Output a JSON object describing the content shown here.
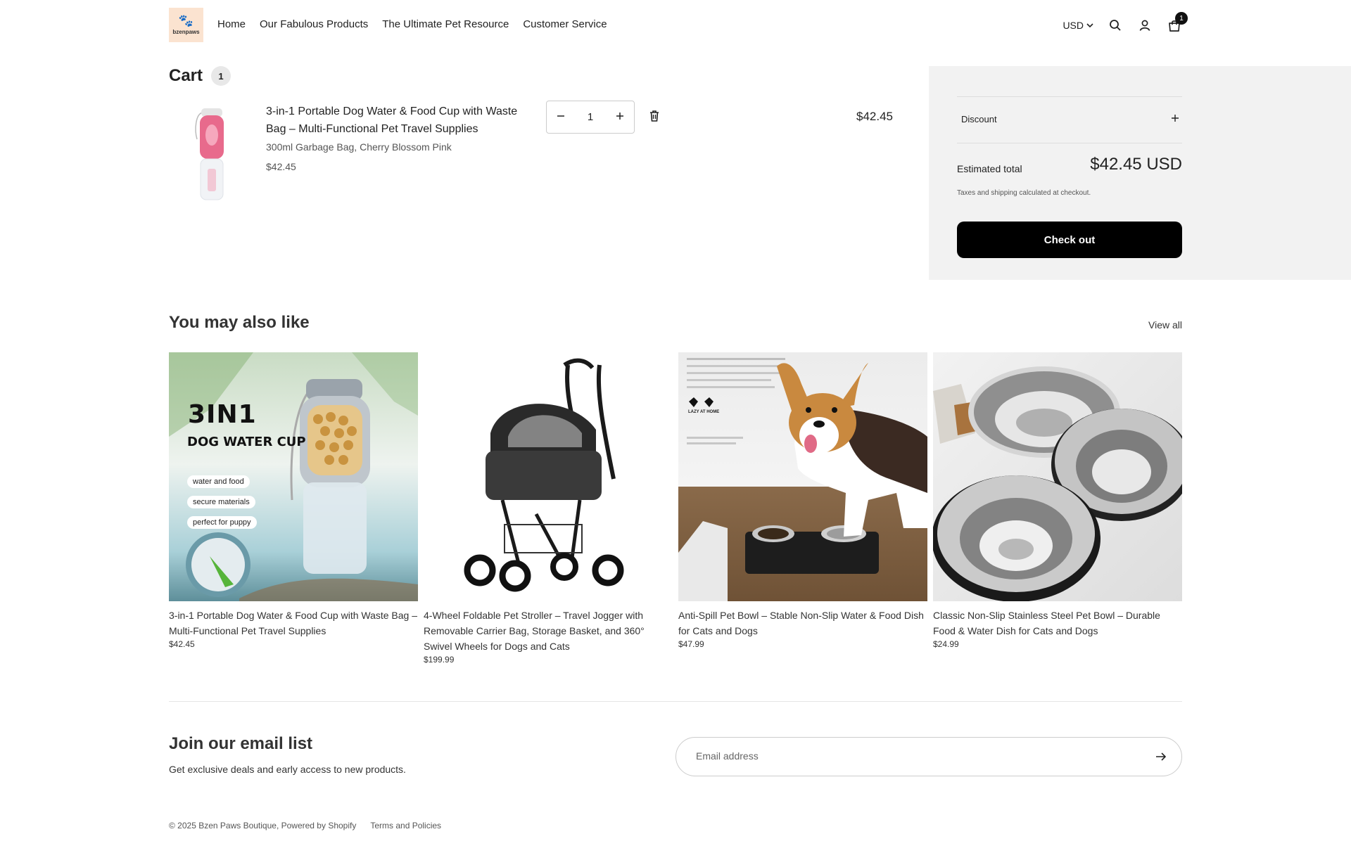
{
  "header": {
    "logo_text": "bzenpaws",
    "nav": [
      "Home",
      "Our Fabulous Products",
      "The Ultimate Pet Resource",
      "Customer Service"
    ],
    "currency": "USD",
    "cart_count": "1"
  },
  "cart": {
    "title": "Cart",
    "count": "1",
    "item": {
      "name": "3-in-1 Portable Dog Water & Food Cup with Waste Bag – Multi-Functional Pet Travel Supplies",
      "variant": "300ml Garbage Bag, Cherry Blossom Pink",
      "price": "$42.45",
      "quantity": "1",
      "line_total": "$42.45"
    }
  },
  "summary": {
    "discount_label": "Discount",
    "estimated_label": "Estimated total",
    "estimated_total": "$42.45 USD",
    "tax_note": "Taxes and shipping calculated at checkout.",
    "checkout_label": "Check out"
  },
  "recommendations": {
    "title": "You may also like",
    "view_all": "View all",
    "products": [
      {
        "title": "3-in-1 Portable Dog Water & Food Cup with Waste Bag – Multi-Functional Pet Travel Supplies",
        "price": "$42.45"
      },
      {
        "title": "4-Wheel Foldable Pet Stroller – Travel Jogger with Removable Carrier Bag, Storage Basket, and 360° Swivel Wheels for Dogs and Cats",
        "price": "$199.99"
      },
      {
        "title": "Anti-Spill Pet Bowl – Stable Non-Slip Water & Food Dish for Cats and Dogs",
        "price": "$47.99"
      },
      {
        "title": "Classic Non-Slip Stainless Steel Pet Bowl – Durable Food & Water Dish for Cats and Dogs",
        "price": "$24.99"
      }
    ],
    "image_text": {
      "headline1": "3IN1",
      "headline2": "DOG WATER CUP",
      "tags": [
        "water and food",
        "secure materials",
        "perfect for puppy"
      ],
      "corgi_caption": "LAZY AT HOME"
    }
  },
  "newsletter": {
    "title": "Join our email list",
    "subtitle": "Get exclusive deals and early access to new products.",
    "placeholder": "Email address"
  },
  "footer": {
    "copyright": "© 2025 Bzen Paws Boutique, Powered by Shopify",
    "terms": "Terms and Policies"
  }
}
